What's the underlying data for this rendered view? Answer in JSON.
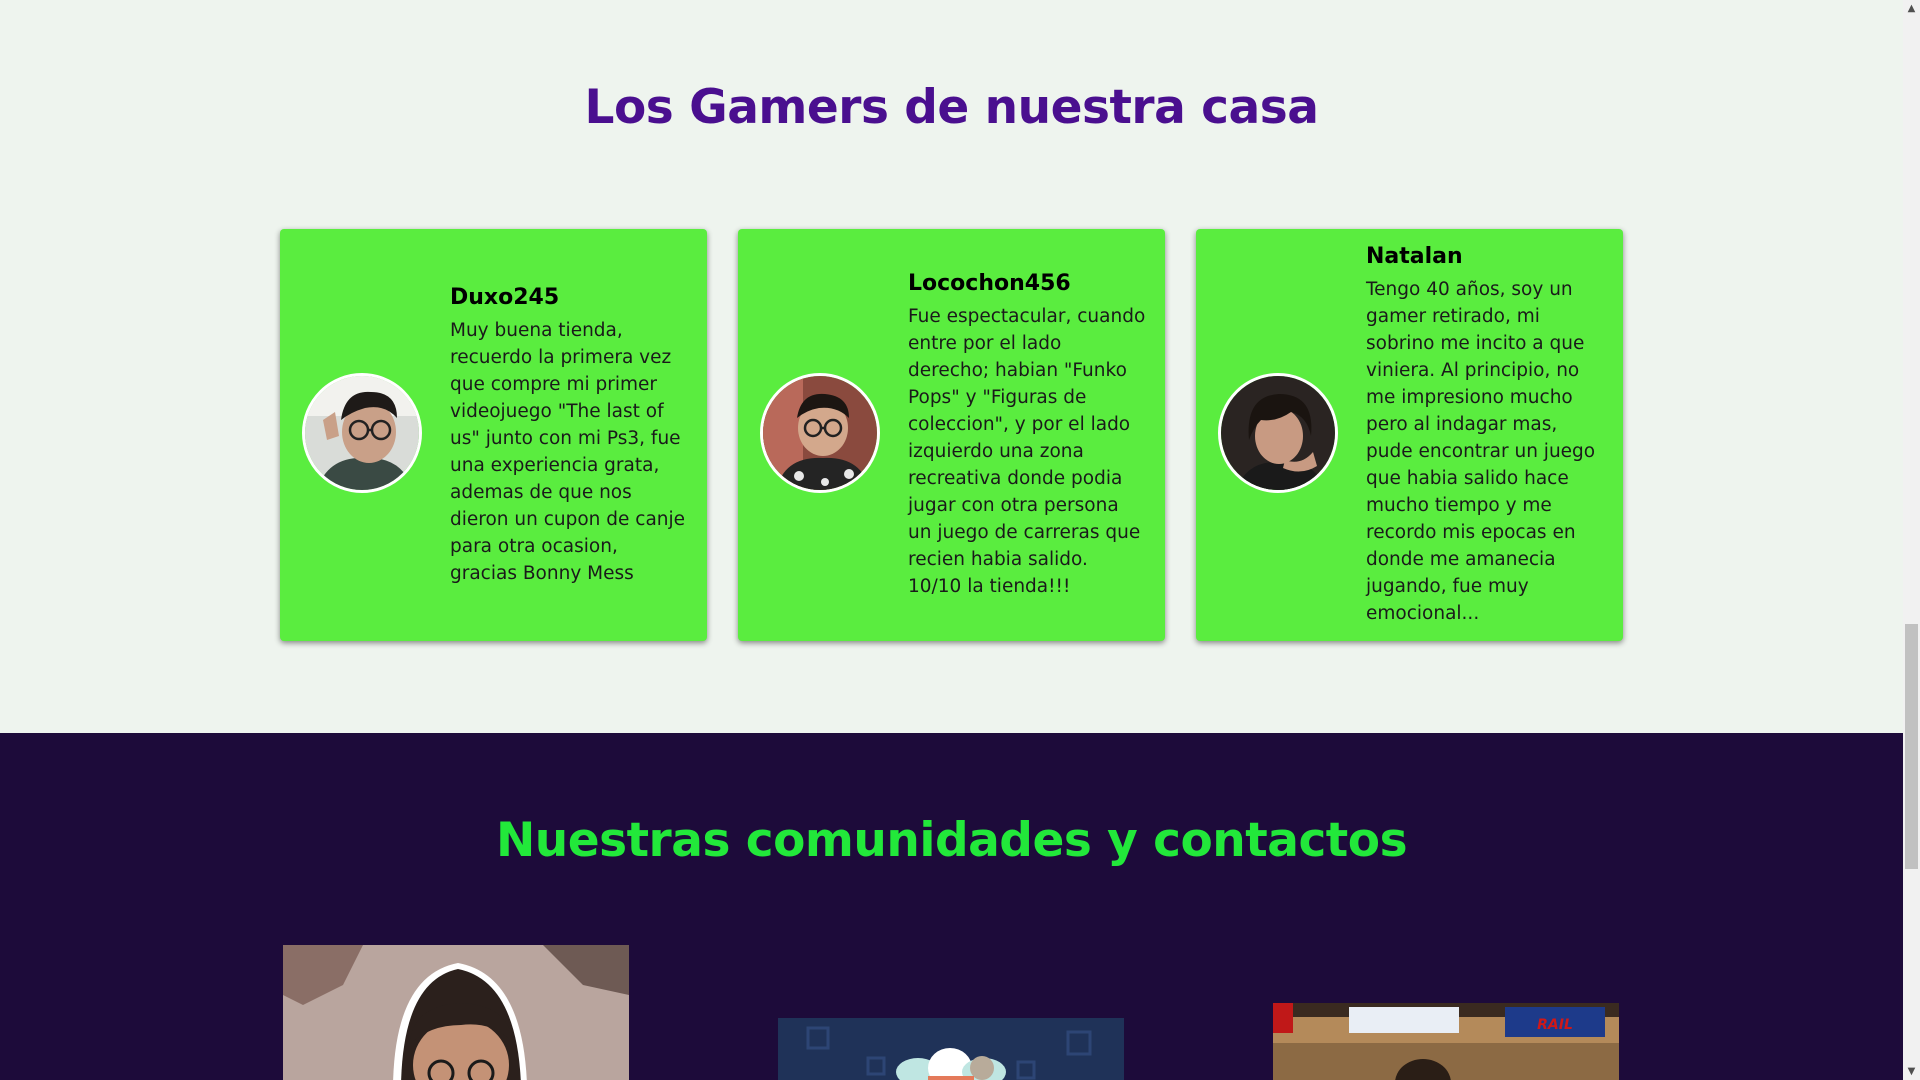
{
  "testimonials": {
    "title": "Los Gamers de nuestra casa",
    "cards": [
      {
        "name": "Duxo245",
        "text": "Muy buena tienda, recuerdo la primera vez que compre mi primer videojuego \"The last of us\" junto con mi Ps3, fue una experiencia grata, ademas de que nos dieron un cupon de canje para otra ocasion, gracias Bonny Mess"
      },
      {
        "name": "Locochon456",
        "text": "Fue espectacular, cuando entre por el lado derecho; habian \"Funko Pops\" y \"Figuras de coleccion\", y por el lado izquierdo una zona recreativa donde podia jugar con otra persona un juego de carreras que recien habia salido. 10/10 la tienda!!!"
      },
      {
        "name": "Natalan",
        "text": "Tengo 40 años, soy un gamer retirado, mi sobrino me incito a que viniera. Al principio, no me impresiono mucho pero al indagar mas, pude encontrar un juego que habia salido hace mucho tiempo y me recordo mis epocas en donde me amanecia jugando, fue muy emocional..."
      }
    ]
  },
  "communities": {
    "title": "Nuestras comunidades y contactos"
  },
  "colors": {
    "testimonials_bg": "#eef4ee",
    "testimonials_title": "#4a0f8f",
    "card_bg": "#5aed3f",
    "communities_bg": "#1d0b3a",
    "communities_title": "#22e83a"
  },
  "scrollbar": {
    "up_icon": "triangle-up-icon",
    "down_icon": "triangle-down-icon"
  }
}
